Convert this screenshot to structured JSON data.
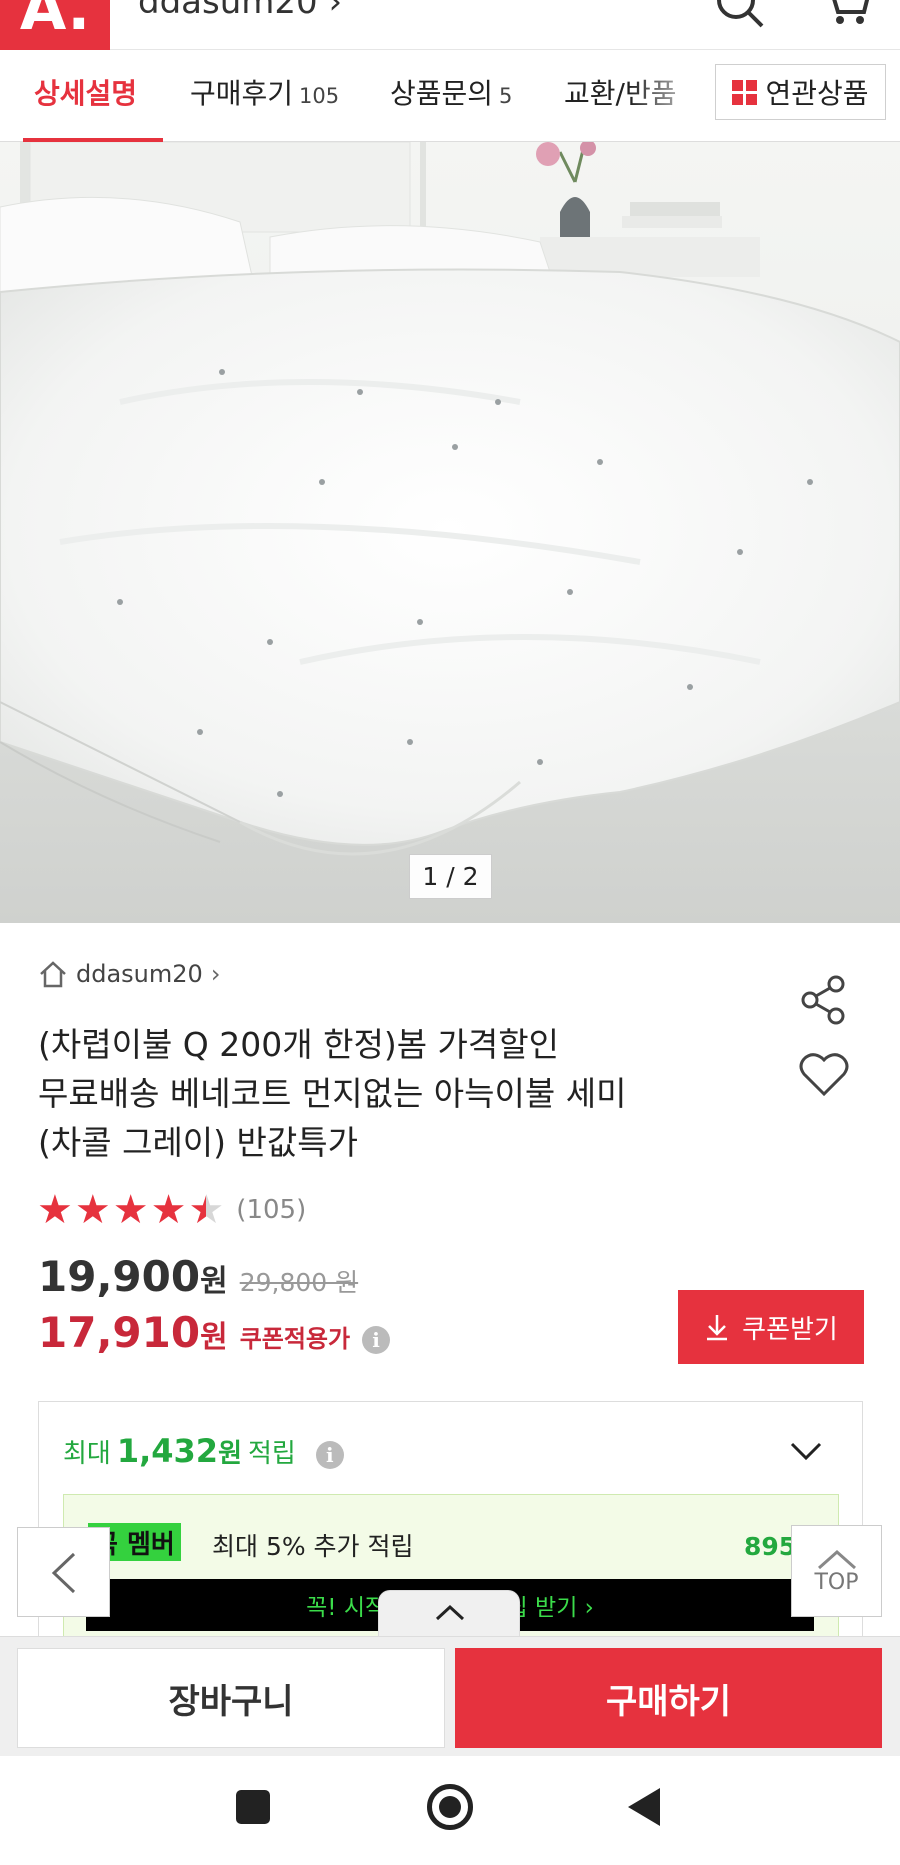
{
  "header": {
    "logo_text": "A.",
    "store_link": "ddasum20 ›",
    "icons": [
      "search-icon",
      "cart-icon"
    ]
  },
  "tabs": [
    {
      "label": "상세설명",
      "count": ""
    },
    {
      "label": "구매후기",
      "count": "105"
    },
    {
      "label": "상품문의",
      "count": "5"
    },
    {
      "label": "교환/반품",
      "count": ""
    }
  ],
  "related_button": "연관상품",
  "image_pager": "1 / 2",
  "product": {
    "seller": "ddasum20",
    "title_lines": [
      "(차렵이불 Q 200개 한정)봄 가격할인",
      "무료배송 베네코트 먼지없는 아늑이불 세미",
      "(차콜 그레이) 반값특가"
    ],
    "rating": 4.5,
    "review_count": "(105)",
    "price": "19,900",
    "price_unit": "원",
    "original_price": "29,800 원",
    "coupon_price": "17,910",
    "coupon_price_unit": "원",
    "coupon_label": "쿠폰적용가",
    "coupon_button": "쿠폰받기"
  },
  "points": {
    "prefix": "최대",
    "amount": "1,432",
    "unit": "원",
    "suffix": "적립",
    "member_badge": "꼭 멤버",
    "member_text": "최대 5% 추가 적립",
    "member_points": "895원",
    "member_cta": "꼭! 시작하고 최대 적립 받기 ›"
  },
  "float": {
    "top_label": "TOP"
  },
  "bottom": {
    "cart_label": "장바구니",
    "buy_label": "구매하기"
  },
  "colors": {
    "accent": "#e6323e",
    "sale": "#c8283a",
    "points_green": "#23a83f",
    "member_green": "#34d13e"
  }
}
